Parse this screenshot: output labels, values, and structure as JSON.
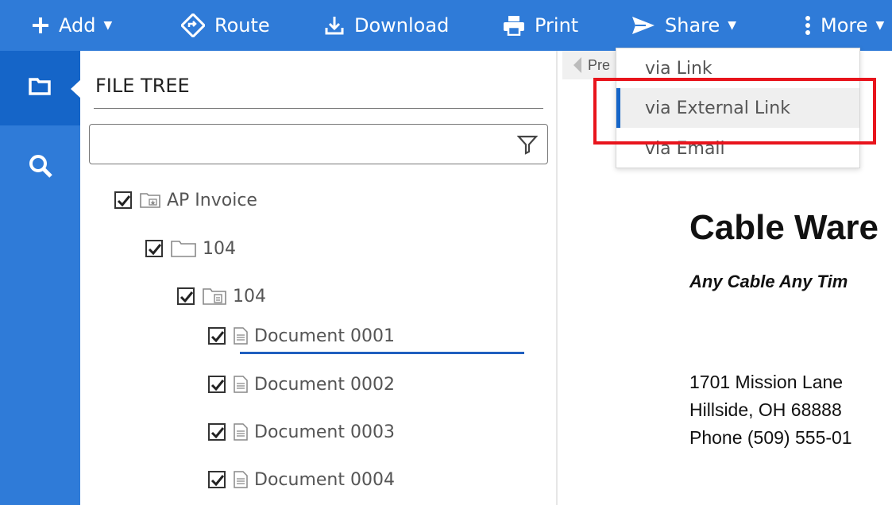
{
  "toolbar": {
    "add_label": "Add",
    "route_label": "Route",
    "download_label": "Download",
    "print_label": "Print",
    "share_label": "Share",
    "more_label": "More"
  },
  "sidebar": {
    "items": [
      {
        "icon": "folder-icon",
        "active": true
      },
      {
        "icon": "search-icon",
        "active": false
      }
    ]
  },
  "file_tree": {
    "title": "FILE TREE",
    "filter_placeholder": "",
    "filter_value": "",
    "nodes": [
      {
        "label": "AP Invoice",
        "icon": "starred-folder-icon",
        "checked": true
      },
      {
        "label": "104",
        "icon": "folder-icon",
        "checked": true
      },
      {
        "label": "104",
        "icon": "document-folder-icon",
        "checked": true
      },
      {
        "label": "Document 0001",
        "icon": "document-icon",
        "checked": true,
        "selected": true
      },
      {
        "label": "Document 0002",
        "icon": "document-icon",
        "checked": true
      },
      {
        "label": "Document 0003",
        "icon": "document-icon",
        "checked": true
      },
      {
        "label": "Document 0004",
        "icon": "document-icon",
        "checked": true
      }
    ]
  },
  "preview": {
    "prev_label": "Pre",
    "company_name": "Cable Ware",
    "tagline": "Any Cable Any Tim",
    "address_line1": "1701 Mission Lane",
    "address_line2": "Hillside, OH  68888",
    "phone": "Phone (509) 555-01"
  },
  "share_menu": {
    "items": [
      {
        "label": "via Link"
      },
      {
        "label": "via External Link",
        "active": true
      },
      {
        "label": "via Email"
      }
    ]
  },
  "colors": {
    "toolbar_blue": "#2f7bd8",
    "rail_active_blue": "#1565c8",
    "highlight_red": "#e8141c"
  }
}
